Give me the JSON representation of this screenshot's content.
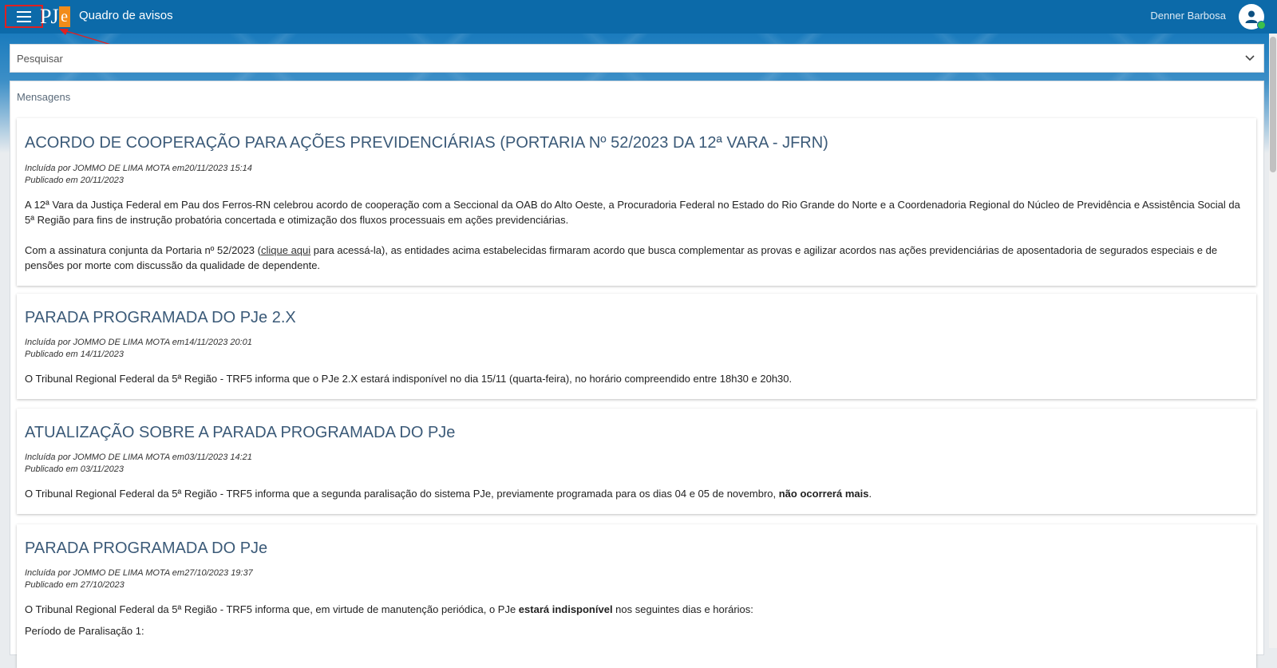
{
  "header": {
    "logo_text": "PJ",
    "logo_accent": "e",
    "title": "Quadro de avisos",
    "user_name": "Denner Barbosa",
    "menu_icon": "hamburger-icon",
    "avatar_icon": "user-icon"
  },
  "search": {
    "label": "Pesquisar",
    "toggle_icon": "chevron-down-icon"
  },
  "messages": {
    "heading": "Mensagens",
    "items": [
      {
        "title": "ACORDO DE COOPERAÇÃO PARA AÇÕES PREVIDENCIÁRIAS (PORTARIA Nº 52/2023 DA 12ª VARA - JFRN)",
        "included": "Incluída por JOMMO DE LIMA MOTA em20/11/2023 15:14",
        "published": "Publicado em 20/11/2023",
        "p1": "A 12ª Vara da Justiça Federal em Pau dos Ferros-RN celebrou acordo de cooperação com a Seccional da OAB do Alto Oeste, a Procuradoria Federal no Estado do Rio Grande do Norte e a Coordenadoria Regional do Núcleo de Previdência e Assistência Social da 5ª Região para fins de instrução probatória concertada e otimização dos fluxos processuais em ações previdenciárias.",
        "p2_before": "Com a assinatura conjunta da Portaria nº 52/2023 (",
        "p2_link": "clique aqui",
        "p2_after": " para acessá-la), as entidades acima estabelecidas firmaram acordo que busca complementar as provas e agilizar acordos nas ações previdenciárias de aposentadoria de segurados especiais e de pensões por morte com discussão da qualidade de dependente."
      },
      {
        "title": "PARADA PROGRAMADA DO PJe 2.X",
        "included": "Incluída por JOMMO DE LIMA MOTA em14/11/2023 20:01",
        "published": "Publicado em 14/11/2023",
        "p1": "O Tribunal Regional Federal da 5ª Região - TRF5 informa que o PJe 2.X estará indisponível no dia 15/11 (quarta-feira), no horário compreendido entre 18h30 e 20h30."
      },
      {
        "title": "ATUALIZAÇÃO SOBRE A PARADA PROGRAMADA DO PJe",
        "included": "Incluída por JOMMO DE LIMA MOTA em03/11/2023 14:21",
        "published": "Publicado em 03/11/2023",
        "p1_before": "O Tribunal Regional Federal da 5ª Região - TRF5 informa que a segunda paralisação do sistema PJe, previamente programada para os dias 04 e 05 de novembro, ",
        "p1_bold": "não ocorrerá mais",
        "p1_after": "."
      },
      {
        "title": "PARADA PROGRAMADA DO PJe",
        "included": "Incluída por JOMMO DE LIMA MOTA em27/10/2023 19:37",
        "published": "Publicado em 27/10/2023",
        "p1_before": "O Tribunal Regional Federal da 5ª Região - TRF5 informa que, em virtude de manutenção periódica, o PJe ",
        "p1_bold": "estará indisponível",
        "p1_after": " nos seguintes dias e horários:",
        "p2": "Período de Paralisação 1:"
      }
    ]
  },
  "colors": {
    "header_bg": "#0c6aa9",
    "logo_accent": "#f28c1a",
    "title_color": "#3b5a78",
    "annotation": "#e02020",
    "status_online": "#3cc04a"
  }
}
